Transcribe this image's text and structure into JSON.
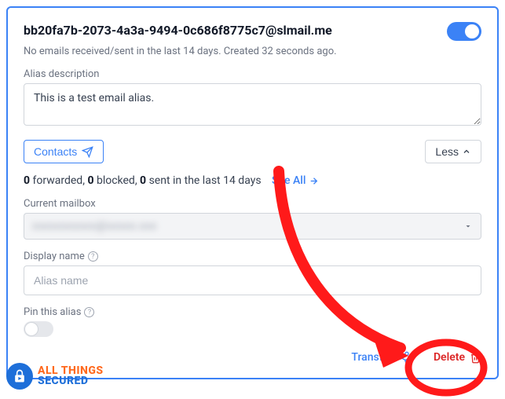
{
  "alias": {
    "email": "bb20fa7b-2073-4a3a-9494-0c686f8775c7@slmail.me",
    "status": "No emails received/sent in the last 14 days. Created 32 seconds ago.",
    "enabled": true
  },
  "description": {
    "label": "Alias description",
    "value": "This is a test email alias."
  },
  "buttons": {
    "contacts": "Contacts",
    "less": "Less"
  },
  "stats": {
    "forwarded": "0",
    "forwarded_label": " forwarded, ",
    "blocked": "0",
    "blocked_label": " blocked, ",
    "sent": "0",
    "sent_label": " sent in the last 14 days",
    "see_all": "See All"
  },
  "mailbox": {
    "label": "Current mailbox",
    "value_obscured": "xxxxxxxxxxx@xxxxx.xxx"
  },
  "display_name": {
    "label": "Display name",
    "placeholder": "Alias name"
  },
  "pin": {
    "label": "Pin this alias"
  },
  "footer": {
    "transfer": "Transfer",
    "delete": "Delete"
  },
  "watermark": {
    "line1": "ALL THINGS",
    "line2": "SECURED"
  },
  "colors": {
    "primary": "#3b82f6",
    "danger": "#dc2626",
    "annotation": "#ff1a1a"
  }
}
